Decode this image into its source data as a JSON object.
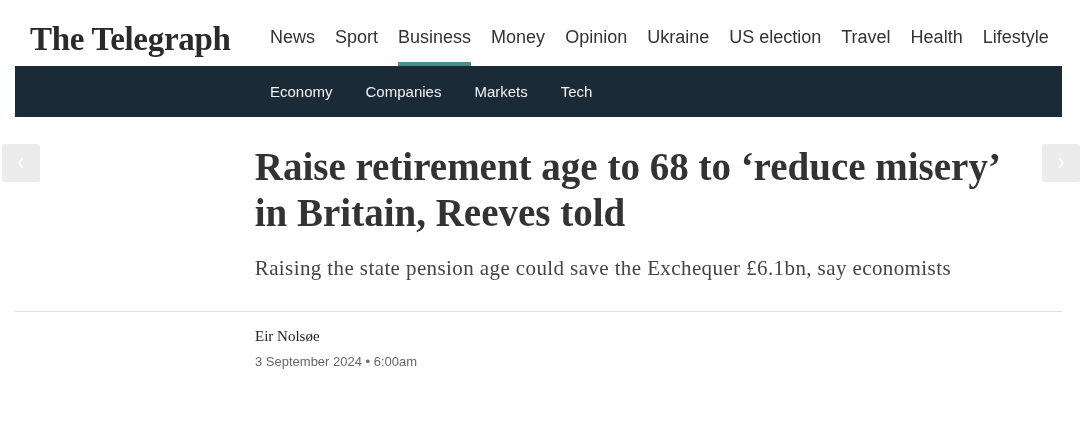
{
  "logo": "The Telegraph",
  "nav": [
    {
      "label": "News",
      "selected": false
    },
    {
      "label": "Sport",
      "selected": false
    },
    {
      "label": "Business",
      "selected": true
    },
    {
      "label": "Money",
      "selected": false
    },
    {
      "label": "Opinion",
      "selected": false
    },
    {
      "label": "Ukraine",
      "selected": false
    },
    {
      "label": "US election",
      "selected": false
    },
    {
      "label": "Travel",
      "selected": false
    },
    {
      "label": "Health",
      "selected": false
    },
    {
      "label": "Lifestyle",
      "selected": false
    }
  ],
  "subnav": [
    "Economy",
    "Companies",
    "Markets",
    "Tech"
  ],
  "article": {
    "headline": "Raise retirement age to 68 to ‘reduce misery’ in Britain, Reeves told",
    "standfirst": "Raising the state pension age could save the Exchequer £6.1bn, say economists",
    "author": "Eir Nolsøe",
    "date": "3 September 2024 • 6:00am"
  }
}
